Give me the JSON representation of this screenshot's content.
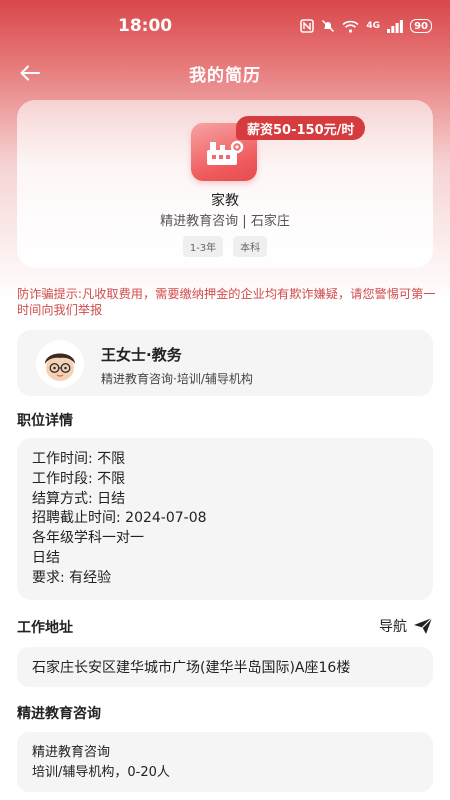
{
  "status_bar": {
    "time": "18:00",
    "network": "4G",
    "battery": "90"
  },
  "header": {
    "title": "我的简历",
    "back_icon": "back-arrow-icon"
  },
  "job": {
    "salary": "薪资50-150元/时",
    "title": "家教",
    "company_location": "精进教育咨询 | 石家庄",
    "tags": [
      "1-3年",
      "本科"
    ],
    "logo_icon": "factory-icon",
    "accent": "#d63b3e"
  },
  "warning": {
    "text": "防诈骗提示:凡收取费用，需要缴纳押金的企业均有欺诈嫌疑，请您警惕可第一时间向我们举报",
    "color": "#d14b4b"
  },
  "recruiter": {
    "name": "王女士·教务",
    "org": "精进教育咨询·培训/辅导机构"
  },
  "details": {
    "section_title": "职位详情",
    "lines": [
      "工作时间:  不限",
      "工作时段:  不限",
      "结算方式:  日结",
      "招聘截止时间:  2024-07-08",
      "各年级学科一对一",
      "日结",
      "要求:  有经验"
    ]
  },
  "address": {
    "section_title": "工作地址",
    "nav_label": "导航",
    "text": "石家庄长安区建华城市广场(建华半岛国际)A座16楼"
  },
  "company": {
    "section_title": "精进教育咨询",
    "name": "精进教育咨询",
    "info": "培训/辅导机构，0-20人"
  }
}
